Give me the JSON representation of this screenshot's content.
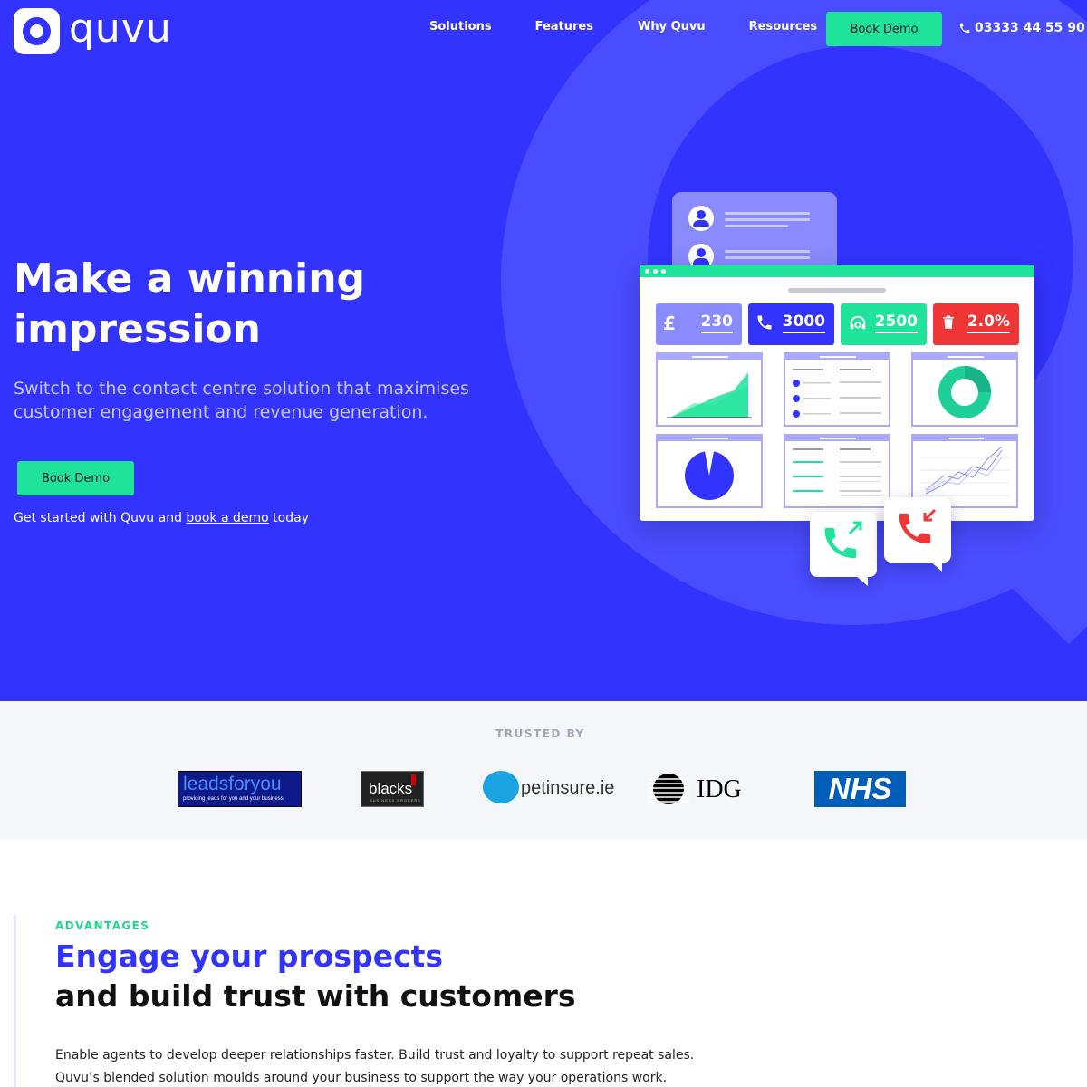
{
  "brand": {
    "name": "quvu"
  },
  "nav": {
    "links": [
      "Solutions",
      "Features",
      "Why Quvu",
      "Resources"
    ],
    "demo_label": "Book Demo",
    "phone": "03333 44 55 90"
  },
  "hero": {
    "title": "Make a winning impression",
    "subtitle": "Switch to the contact centre solution that maximises customer engagement and revenue generation.",
    "demo_label": "Book Demo",
    "cta_prefix": "Get started with Quvu and ",
    "cta_link": "book a demo",
    "cta_suffix": " today"
  },
  "dashboard": {
    "stats": [
      {
        "icon": "pound-icon",
        "value": "230",
        "color": "#8a8bff"
      },
      {
        "icon": "phone-icon",
        "value": "3000",
        "color": "#3333ff"
      },
      {
        "icon": "headset-icon",
        "value": "2500",
        "color": "#1fe39b"
      },
      {
        "icon": "trash-icon",
        "value": "2.0%",
        "color": "#ef3535"
      }
    ]
  },
  "trusted": {
    "label": "TRUSTED BY",
    "logos": [
      {
        "name": "leadsforyou",
        "tagline": "providing leads for you and your business"
      },
      {
        "name": "blacks",
        "tagline": "BUSINESS BROKERS"
      },
      {
        "name": "petinsure.ie",
        "tagline": ""
      },
      {
        "name": "IDG",
        "tagline": ""
      },
      {
        "name": "NHS",
        "tagline": ""
      }
    ]
  },
  "advantages": {
    "kicker": "ADVANTAGES",
    "title_line1": "Engage your prospects",
    "title_line2": "and build trust with customers",
    "body": "Enable agents to develop deeper relationships faster. Build trust and loyalty to support repeat sales. Quvu’s blended solution moulds around your business to support the way your operations work."
  },
  "colors": {
    "primary": "#3333ff",
    "accent": "#1fe39b",
    "danger": "#ef3535"
  }
}
